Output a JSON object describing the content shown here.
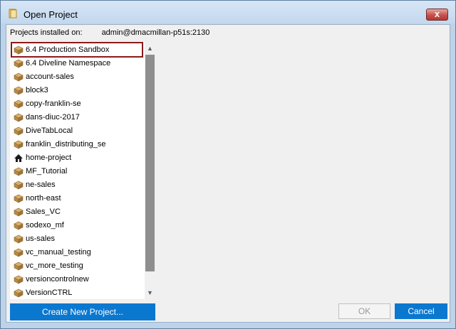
{
  "window": {
    "title": "Open Project",
    "close_glyph": "x"
  },
  "header": {
    "label": "Projects installed on:",
    "host": "admin@dmacmillan-p51s:2130"
  },
  "projects": [
    {
      "label": "6.4 Production Sandbox",
      "icon": "package-icon",
      "selected": true
    },
    {
      "label": "6.4 Diveline Namespace",
      "icon": "package-icon"
    },
    {
      "label": "account-sales",
      "icon": "package-icon"
    },
    {
      "label": "block3",
      "icon": "package-icon"
    },
    {
      "label": "copy-franklin-se",
      "icon": "package-icon"
    },
    {
      "label": "dans-diuc-2017",
      "icon": "package-icon"
    },
    {
      "label": "DiveTabLocal",
      "icon": "package-icon"
    },
    {
      "label": "franklin_distributing_se",
      "icon": "package-icon"
    },
    {
      "label": "home-project",
      "icon": "home-icon"
    },
    {
      "label": "MF_Tutorial",
      "icon": "package-icon"
    },
    {
      "label": "ne-sales",
      "icon": "package-icon"
    },
    {
      "label": "north-east",
      "icon": "package-icon"
    },
    {
      "label": "Sales_VC",
      "icon": "package-icon"
    },
    {
      "label": "sodexo_mf",
      "icon": "package-icon"
    },
    {
      "label": "us-sales",
      "icon": "package-icon"
    },
    {
      "label": "vc_manual_testing",
      "icon": "package-icon"
    },
    {
      "label": "vc_more_testing",
      "icon": "package-icon"
    },
    {
      "label": "versioncontrolnew",
      "icon": "package-icon"
    },
    {
      "label": "VersionCTRL",
      "icon": "package-icon"
    }
  ],
  "buttons": {
    "create": "Create New Project...",
    "ok": "OK",
    "cancel": "Cancel"
  },
  "colors": {
    "accent": "#0b78d0",
    "selection_outline": "#8b1a1a"
  }
}
